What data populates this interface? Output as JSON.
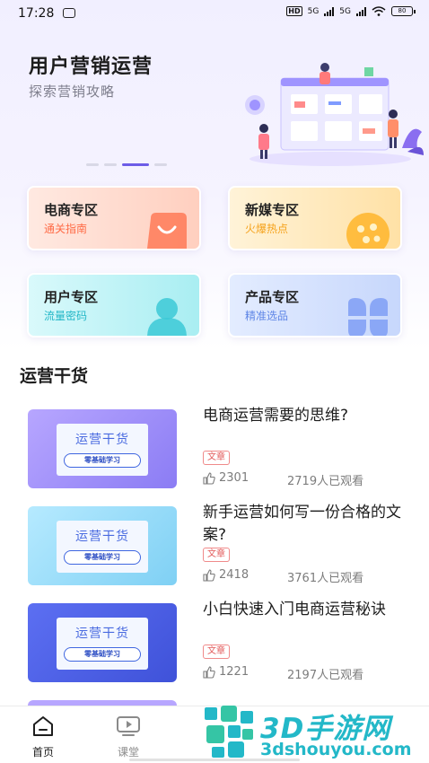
{
  "status_bar": {
    "time": "17:28",
    "hd": "HD",
    "net1": "5G",
    "net2": "5G",
    "battery": "80"
  },
  "banner": {
    "title": "用户营销运营",
    "subtitle": "探索营销攻略",
    "carousel_pages": 4,
    "carousel_active_index": 2
  },
  "categories": [
    {
      "title": "电商专区",
      "subtitle": "通关指南",
      "icon": "shopping-bag-icon",
      "accent": "#ff6b46"
    },
    {
      "title": "新媒专区",
      "subtitle": "火爆热点",
      "icon": "film-reel-icon",
      "accent": "#f5a21b"
    },
    {
      "title": "用户专区",
      "subtitle": "流量密码",
      "icon": "user-icon",
      "accent": "#23b7c7"
    },
    {
      "title": "产品专区",
      "subtitle": "精准选品",
      "icon": "clover-grid-icon",
      "accent": "#5f86e6"
    }
  ],
  "section": {
    "title": "运营干货"
  },
  "thumbnail": {
    "line1": "运营干货",
    "line2": "零基础学习"
  },
  "articles": [
    {
      "title": "电商运营需要的思维?",
      "tag": "文章",
      "likes": "2301",
      "views": "2719人已观看"
    },
    {
      "title": "新手运营如何写一份合格的文案?",
      "tag": "文章",
      "likes": "2418",
      "views": "3761人已观看"
    },
    {
      "title": "小白快速入门电商运营秘诀",
      "tag": "文章",
      "likes": "1221",
      "views": "2197人已观看"
    }
  ],
  "tabbar": {
    "home": "首页",
    "classroom": "课堂"
  },
  "watermark": {
    "big": "3D手游网",
    "small": "3dshouyou.com"
  }
}
